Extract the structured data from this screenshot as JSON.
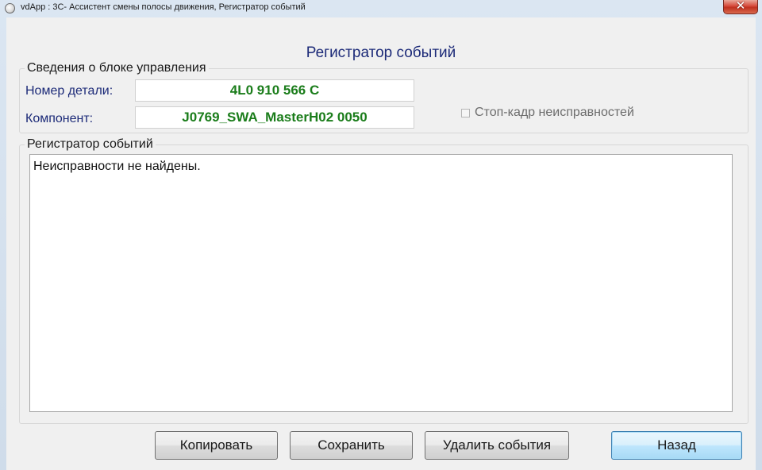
{
  "window": {
    "title": "vdApp : 3C- Ассистент смены полосы движения,  Регистратор событий",
    "close_symbol": "✕"
  },
  "page_title": "Регистратор событий",
  "control_unit": {
    "legend": "Сведения о блоке управления",
    "part_number_label": "Номер детали:",
    "part_number_value": "4L0 910 566 C",
    "component_label": "Компонент:",
    "component_value": "J0769_SWA_MasterH02 0050",
    "freeze_frame_label": "Стоп-кадр неисправностей",
    "freeze_frame_checked": false
  },
  "event_log": {
    "legend": "Регистратор событий",
    "content": "Неисправности не найдены."
  },
  "buttons": {
    "copy": "Копировать",
    "save": "Сохранить",
    "delete": "Удалить события",
    "back": "Назад"
  },
  "colors": {
    "label_blue": "#1c2a78",
    "value_green": "#1b7d1b"
  }
}
